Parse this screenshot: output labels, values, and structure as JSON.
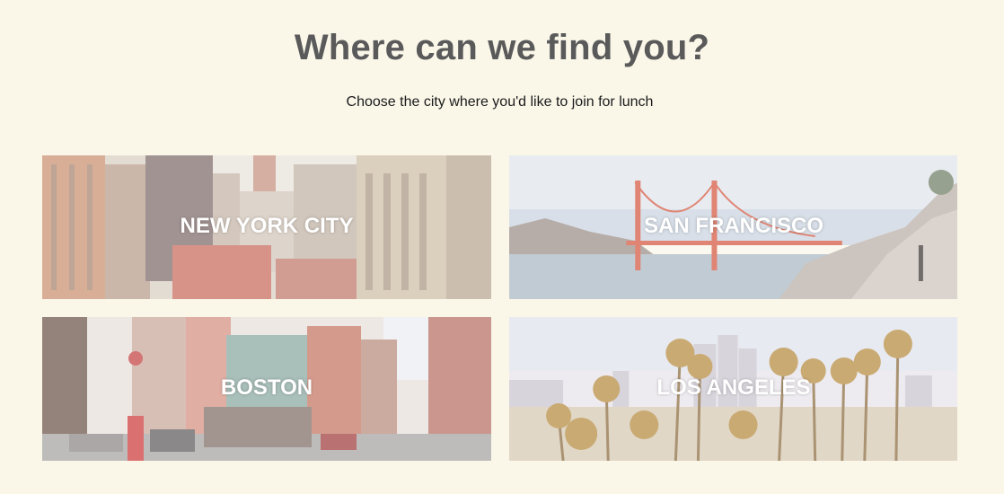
{
  "header": {
    "title": "Where can we find you?",
    "subtitle": "Choose the city where you'd like to join for lunch"
  },
  "cities": [
    {
      "label": "NEW YORK CITY"
    },
    {
      "label": "SAN FRANCISCO"
    },
    {
      "label": "BOSTON"
    },
    {
      "label": "LOS ANGELES"
    }
  ],
  "colors": {
    "background": "#faf7e9",
    "title": "#5a5a5a",
    "label": "#ffffff"
  }
}
